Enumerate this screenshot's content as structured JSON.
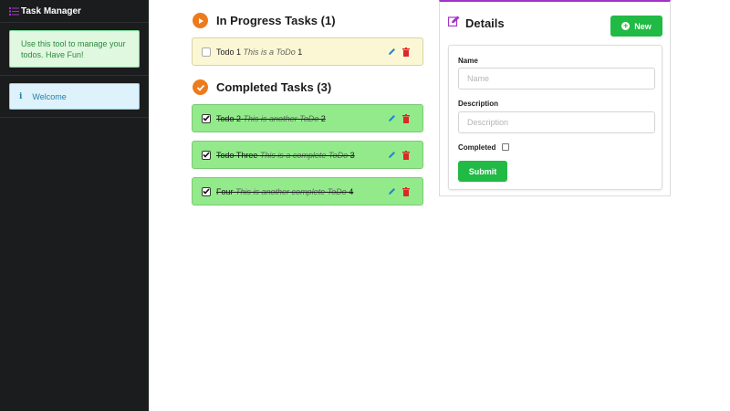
{
  "app": {
    "title": "Task Manager"
  },
  "sidebar": {
    "message_intro": "Use this tool to manage your todos. Have Fun!",
    "message_welcome": "Welcome",
    "info_glyph": "i"
  },
  "in_progress": {
    "heading": "In Progress Tasks (1)",
    "tasks": [
      {
        "name": "Todo 1",
        "description": "This is a ToDo",
        "id": "1",
        "completed": false
      }
    ]
  },
  "completed": {
    "heading": "Completed Tasks (3)",
    "tasks": [
      {
        "name": "Todo 2",
        "description": "This is another ToDo",
        "id": "2",
        "completed": true
      },
      {
        "name": "Todo Three",
        "description": "This is a complete ToDo",
        "id": "3",
        "completed": true
      },
      {
        "name": "Four",
        "description": "This is another complete ToDo",
        "id": "4",
        "completed": true
      }
    ]
  },
  "details": {
    "heading": "Details",
    "new_label": "New",
    "name_label": "Name",
    "name_placeholder": "Name",
    "name_value": "",
    "description_label": "Description",
    "description_placeholder": "Description",
    "description_value": "",
    "completed_label": "Completed",
    "completed_checked": false,
    "submit_label": "Submit"
  },
  "icons": {
    "brand": "list-icon",
    "in_progress": "play-circle-icon",
    "completed": "check-circle-icon",
    "edit": "pencil-icon",
    "delete": "trash-icon",
    "details": "edit-icon",
    "new": "plus-circle-icon",
    "info": "info-icon"
  },
  "colors": {
    "sidebar_bg": "#1b1c1d",
    "accent_purple": "#a333c8",
    "accent_orange": "#ec7b1e",
    "button_green": "#21ba45",
    "progress_row": "#fbf7d4",
    "done_row": "#93ea8b",
    "edit_blue": "#2185d0",
    "delete_red": "#db2828"
  }
}
